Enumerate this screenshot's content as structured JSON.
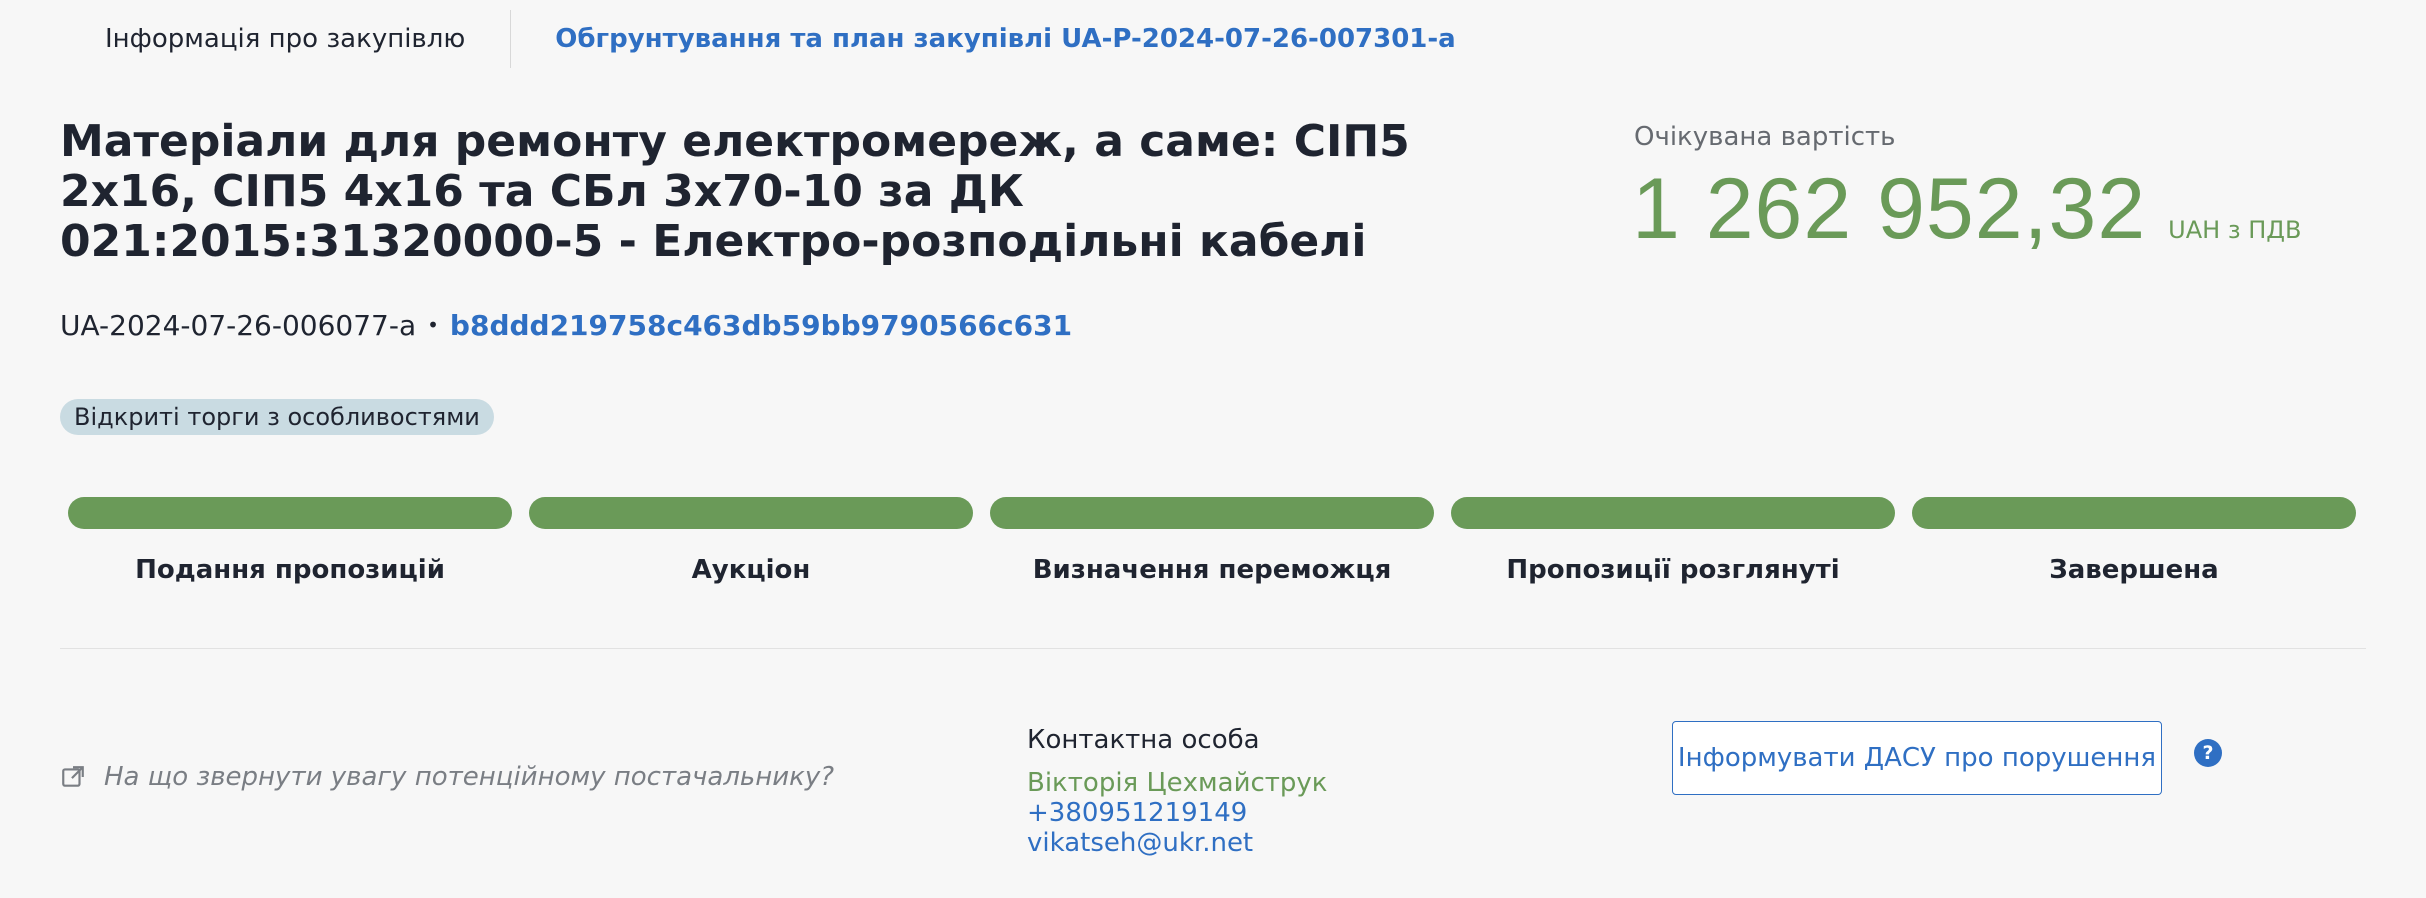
{
  "tabs": {
    "info": "Інформація про закупівлю",
    "plan": "Обгрунтування та план закупівлі UA-P-2024-07-26-007301-a"
  },
  "tender": {
    "title": "Матеріали для ремонту електромереж, а саме: СІП5 2х16, СІП5 4х16 та СБл 3х70-10 за ДК 021:2015:31320000-5 - Електро-розподільні кабелі",
    "id": "UA-2024-07-26-006077-a",
    "separator": "•",
    "hash": "b8ddd219758c463db59bb9790566c631",
    "procedure_type": "Відкриті торги з особливостями"
  },
  "value": {
    "label": "Очікувана вартість",
    "amount": "1 262 952,32",
    "currency": "UAH з ПДВ"
  },
  "stages": [
    {
      "label": "Подання пропозицій",
      "status": "completed"
    },
    {
      "label": "Аукціон",
      "status": "completed"
    },
    {
      "label": "Визначення переможця",
      "status": "completed"
    },
    {
      "label": "Пропозиції розглянуті",
      "status": "completed"
    },
    {
      "label": "Завершена",
      "status": "completed"
    }
  ],
  "hint": {
    "icon": "external-link-icon",
    "text": "На що звернути увагу потенційному постачальнику?"
  },
  "contact": {
    "heading": "Контактна особа",
    "name": "Вікторія Цехмайструк",
    "phone": "+380951219149",
    "email": "vikatseh@ukr.net"
  },
  "actions": {
    "dasu_button": "Інформувати ДАСУ про порушення",
    "help_icon": "?"
  },
  "colors": {
    "accent_green": "#6a9a58",
    "link_blue": "#2f6fc3",
    "badge_bg": "#c9dbe2"
  }
}
